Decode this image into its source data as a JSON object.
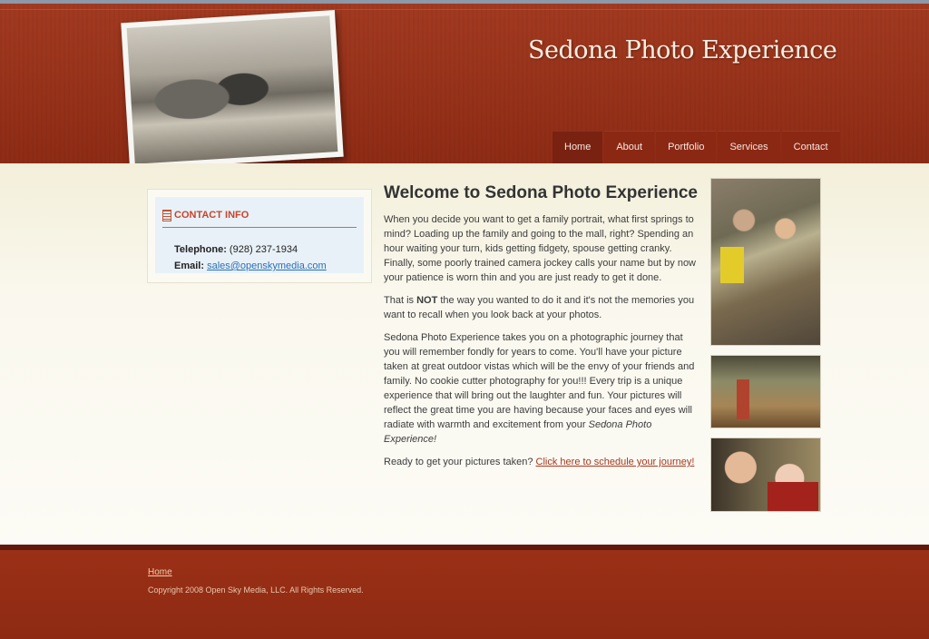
{
  "header": {
    "site_title": "Sedona Photo Experience"
  },
  "nav": {
    "items": [
      "Home",
      "About",
      "Portfolio",
      "Services",
      "Contact"
    ]
  },
  "sidebar": {
    "contact_title": "CONTACT INFO",
    "telephone_label": "Telephone:",
    "telephone_value": "(928) 237-1934",
    "email_label": "Email:",
    "email_value": "sales@openskymedia.com"
  },
  "main": {
    "heading": "Welcome to Sedona Photo Experience",
    "p1": "When you decide you want to get a family portrait, what first springs to mind? Loading up the family and going to the mall, right? Spending an hour waiting your turn, kids getting fidgety, spouse getting cranky. Finally, some poorly trained camera jockey calls your name but by now your patience is worn thin and you are just ready to get it done.",
    "p2_before": "That is ",
    "p2_bold": "NOT",
    "p2_after": " the way you wanted to do it and it's not the memories you want to recall when you look back at your photos.",
    "p3": "Sedona Photo Experience takes you on a photographic journey that you will remember fondly for years to come. You'll have your picture taken at great outdoor vistas which will be the envy of your friends and family. No cookie cutter photography for you!!! Every trip is a unique experience that will bring out the laughter and fun. Your pictures will reflect the great time you are having because your faces and eyes will radiate with warmth and excitement from your",
    "p3_italic": "Sedona Photo Experience!",
    "p4_text": "Ready to get your pictures taken? ",
    "p4_link": "Click here to schedule your journey!"
  },
  "footer": {
    "home_link": "Home",
    "copyright": "Copyright 2008 Open Sky Media, LLC. All Rights Reserved."
  },
  "colors": {
    "header_red": "#a23a20",
    "nav_bg": "#8b2814",
    "link_red": "#a6381f",
    "email_blue": "#2a6fb5"
  }
}
